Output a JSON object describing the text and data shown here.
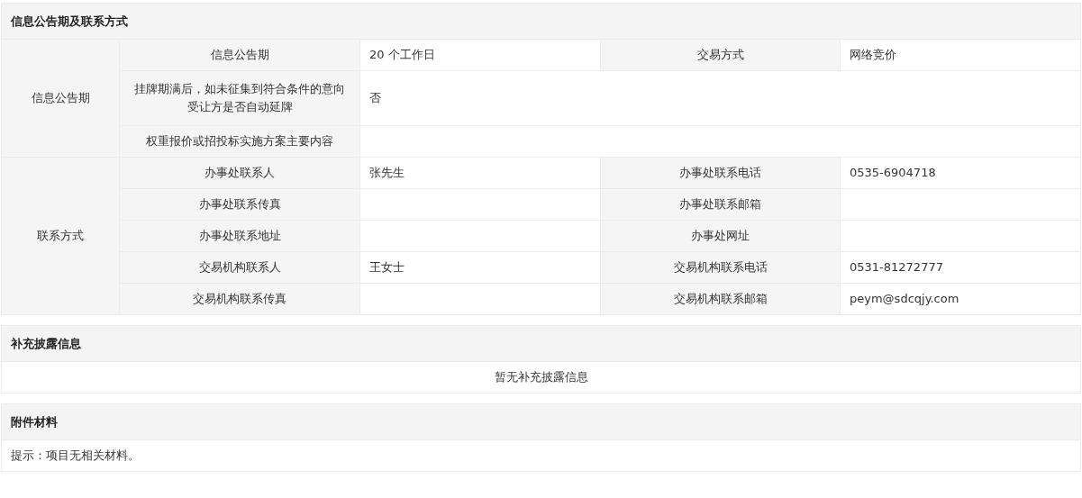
{
  "sections": [
    {
      "title": "信息公告期及联系方式",
      "kind": "grid",
      "groups": [
        {
          "label": "信息公告期",
          "rows": [
            {
              "cells": [
                {
                  "label": "信息公告期",
                  "value": "20 个工作日"
                },
                {
                  "label": "交易方式",
                  "value": "网络竞价"
                }
              ]
            },
            {
              "cells": [
                {
                  "label": "挂牌期满后，如未征集到符合条件的意向受让方是否自动延牌",
                  "value": "否"
                }
              ]
            },
            {
              "cells": [
                {
                  "label": "权重报价或招投标实施方案主要内容"
                }
              ]
            }
          ]
        },
        {
          "label": "联系方式",
          "rows": [
            {
              "cells": [
                {
                  "label": "办事处联系人",
                  "value": "张先生"
                },
                {
                  "label": "办事处联系电话",
                  "value": "0535-6904718"
                }
              ]
            },
            {
              "cells": [
                {
                  "label": "办事处联系传真"
                },
                {
                  "label": "办事处联系邮箱"
                }
              ]
            },
            {
              "cells": [
                {
                  "label": "办事处联系地址"
                },
                {
                  "label": "办事处网址"
                }
              ]
            },
            {
              "cells": [
                {
                  "label": "交易机构联系人",
                  "value": "王女士"
                },
                {
                  "label": "交易机构联系电话",
                  "value": "0531-81272777"
                }
              ]
            },
            {
              "cells": [
                {
                  "label": "交易机构联系传真"
                },
                {
                  "label": "交易机构联系邮箱",
                  "value": "peym@sdcqjy.com"
                }
              ]
            }
          ]
        }
      ]
    },
    {
      "title": "补充披露信息",
      "kind": "centered-note",
      "text": "暂无补充披露信息"
    },
    {
      "title": "附件材料",
      "kind": "note",
      "text": "提示：项目无相关材料。"
    }
  ]
}
